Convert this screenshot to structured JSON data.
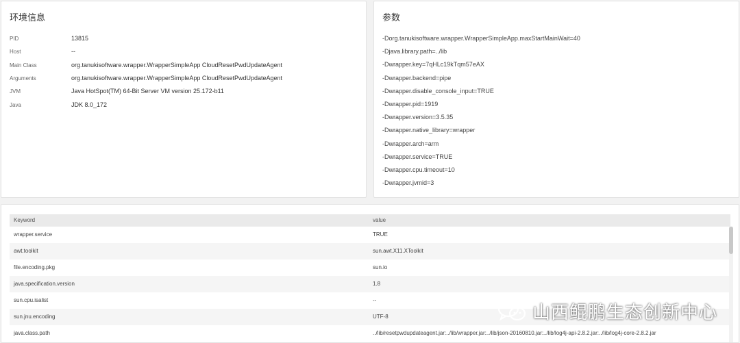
{
  "env_panel": {
    "title": "环境信息",
    "rows": [
      {
        "key": "PID",
        "value": "13815"
      },
      {
        "key": "Host",
        "value": "--"
      },
      {
        "key": "Main Class",
        "value": "org.tanukisoftware.wrapper.WrapperSimpleApp CloudResetPwdUpdateAgent"
      },
      {
        "key": "Arguments",
        "value": "org.tanukisoftware.wrapper.WrapperSimpleApp CloudResetPwdUpdateAgent"
      },
      {
        "key": "JVM",
        "value": "Java HotSpot(TM) 64-Bit Server VM version 25.172-b11"
      },
      {
        "key": "Java",
        "value": "JDK 8.0_172"
      }
    ]
  },
  "params_panel": {
    "title": "参数",
    "lines": [
      "-Dorg.tanukisoftware.wrapper.WrapperSimpleApp.maxStartMainWait=40",
      "-Djava.library.path=../lib",
      "-Dwrapper.key=7qHLc19kTqm57eAX",
      "-Dwrapper.backend=pipe",
      "-Dwrapper.disable_console_input=TRUE",
      "-Dwrapper.pid=1919",
      "-Dwrapper.version=3.5.35",
      "-Dwrapper.native_library=wrapper",
      "-Dwrapper.arch=arm",
      "-Dwrapper.service=TRUE",
      "-Dwrapper.cpu.timeout=10",
      "-Dwrapper.jvmid=3"
    ]
  },
  "props_table": {
    "headers": {
      "keyword": "Keyword",
      "value": "value"
    },
    "rows": [
      {
        "keyword": "wrapper.service",
        "value": "TRUE"
      },
      {
        "keyword": "awt.toolkit",
        "value": "sun.awt.X11.XToolkit"
      },
      {
        "keyword": "file.encoding.pkg",
        "value": "sun.io"
      },
      {
        "keyword": "java.specification.version",
        "value": "1.8"
      },
      {
        "keyword": "sun.cpu.isalist",
        "value": "--"
      },
      {
        "keyword": "sun.jnu.encoding",
        "value": "UTF-8"
      },
      {
        "keyword": "java.class.path",
        "value": "../lib/resetpwdupdateagent.jar:../lib/wrapper.jar:../lib/json-20160810.jar:../lib/log4j-api-2.8.2.jar:../lib/log4j-core-2.8.2.jar"
      }
    ]
  },
  "watermark": {
    "text": "山西鲲鹏生态创新中心",
    "icon": "wechat-icon"
  }
}
